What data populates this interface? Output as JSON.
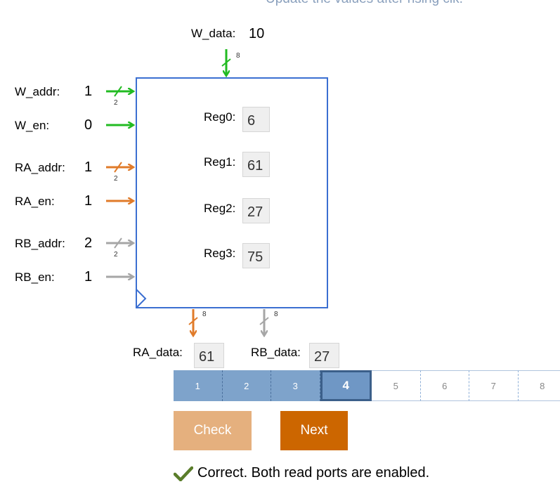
{
  "instruction": "Update the values after rising clk.",
  "w_data": {
    "label": "W_data:",
    "value": "10",
    "width": "8"
  },
  "inputs": [
    {
      "key": "w_addr",
      "label": "W_addr:",
      "value": "1",
      "width": "2",
      "color": "#22bb22"
    },
    {
      "key": "w_en",
      "label": "W_en:",
      "value": "0",
      "color": "#22bb22"
    },
    {
      "key": "ra_addr",
      "label": "RA_addr:",
      "value": "1",
      "width": "2",
      "color": "#e07b2a"
    },
    {
      "key": "ra_en",
      "label": "RA_en:",
      "value": "1",
      "color": "#e07b2a"
    },
    {
      "key": "rb_addr",
      "label": "RB_addr:",
      "value": "2",
      "width": "2",
      "color": "#a6a6a6"
    },
    {
      "key": "rb_en",
      "label": "RB_en:",
      "value": "1",
      "color": "#a6a6a6"
    }
  ],
  "registers": [
    {
      "label": "Reg0:",
      "value": "6"
    },
    {
      "label": "Reg1:",
      "value": "61"
    },
    {
      "label": "Reg2:",
      "value": "27"
    },
    {
      "label": "Reg3:",
      "value": "75"
    }
  ],
  "outputs": {
    "ra": {
      "label": "RA_data:",
      "value": "61",
      "width": "8"
    },
    "rb": {
      "label": "RB_data:",
      "value": "27",
      "width": "8"
    }
  },
  "steps": [
    "1",
    "2",
    "3",
    "4",
    "5",
    "6",
    "7",
    "8"
  ],
  "current_step": "4",
  "buttons": {
    "check": "Check",
    "next": "Next"
  },
  "feedback": {
    "text": "Correct. Both read ports are enabled.",
    "icon": "checkmark-icon"
  },
  "colors": {
    "block_border": "#3b6fd1",
    "green": "#22bb22",
    "orange": "#e07b2a",
    "gray": "#a6a6a6",
    "next_button": "#cc6600",
    "check_button": "#e5b07e",
    "step_done": "#7ea3cb"
  }
}
